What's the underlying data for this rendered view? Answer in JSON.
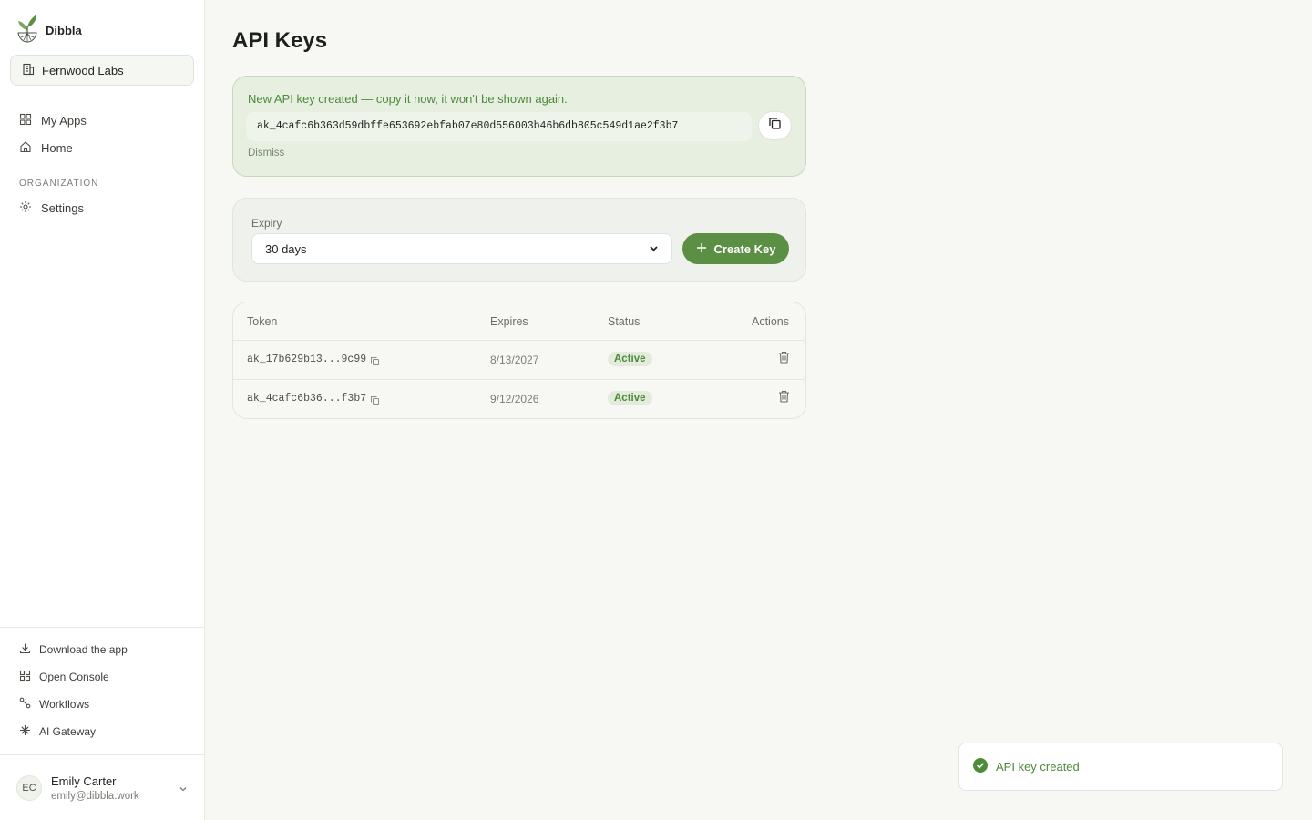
{
  "app": {
    "name": "Dibbla",
    "logo_icon": "sprout-logo-icon"
  },
  "org": {
    "name": "Fernwood Labs",
    "icon": "building-icon"
  },
  "nav": {
    "items": [
      {
        "label": "My Apps",
        "icon": "grid-icon"
      },
      {
        "label": "Home",
        "icon": "home-icon"
      }
    ],
    "section_label": "ORGANIZATION",
    "org_items": [
      {
        "label": "Settings",
        "icon": "gear-icon"
      }
    ]
  },
  "footer": {
    "links": [
      {
        "label": "Download the app",
        "icon": "download-icon"
      },
      {
        "label": "Open Console",
        "icon": "grid-icon"
      },
      {
        "label": "Workflows",
        "icon": "workflow-icon"
      },
      {
        "label": "AI Gateway",
        "icon": "sparkle-icon"
      }
    ]
  },
  "user": {
    "initials": "EC",
    "name": "Emily Carter",
    "email": "emily@dibbla.work"
  },
  "page": {
    "title": "API Keys"
  },
  "new_key": {
    "message": "New API key created — copy it now, it won't be shown again.",
    "key": "ak_4cafc6b363d59dbffe653692ebfab07e80d556003b46b6db805c549d1ae2f3b7",
    "dismiss": "Dismiss"
  },
  "create": {
    "expiry_label": "Expiry",
    "expiry_value": "30 days",
    "button_label": "Create Key"
  },
  "table": {
    "columns": [
      "Token",
      "Expires",
      "Status",
      "Actions"
    ],
    "rows": [
      {
        "token": "ak_17b629b13...9c99",
        "expires": "8/13/2027",
        "status": "Active"
      },
      {
        "token": "ak_4cafc6b36...f3b7",
        "expires": "9/12/2026",
        "status": "Active"
      }
    ]
  },
  "toast": {
    "message": "API key created",
    "icon": "check-circle-icon"
  },
  "colors": {
    "accent": "#5a8f44",
    "accent_text": "#4d8a3a",
    "notice_bg": "#e6efe0",
    "page_bg": "#f7f8f4"
  }
}
